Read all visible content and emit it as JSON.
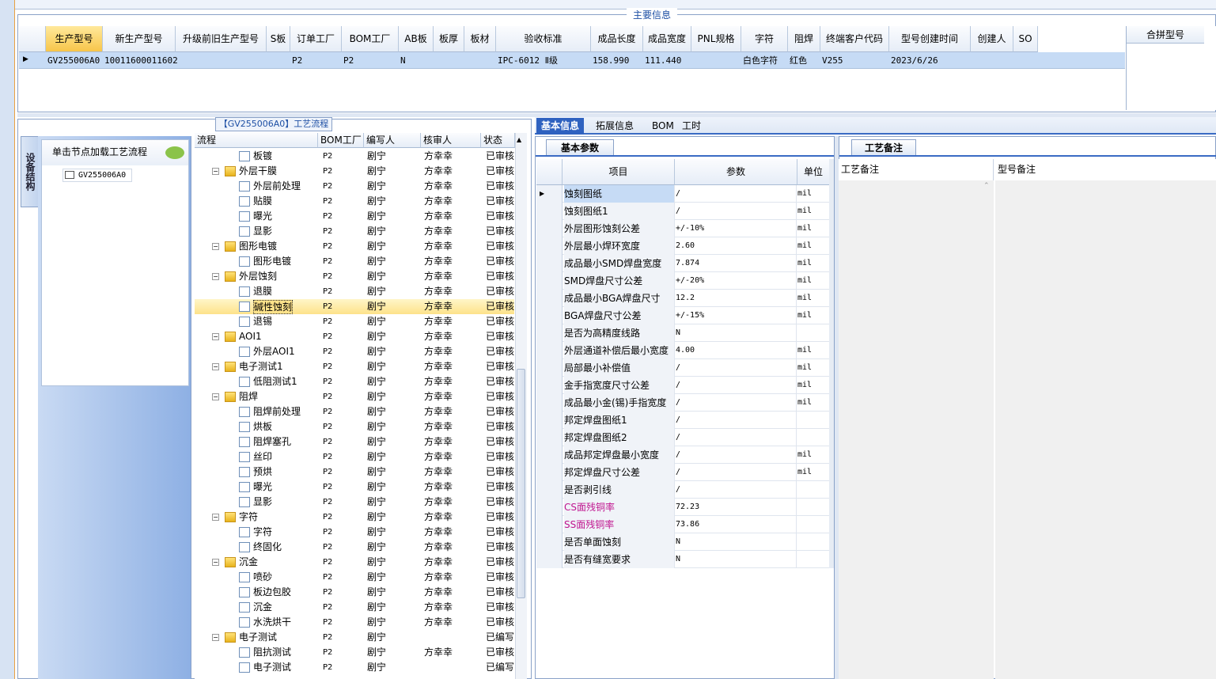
{
  "main_info": {
    "legend": "主要信息",
    "columns": [
      "生产型号",
      "新生产型号",
      "升级前旧生产型号",
      "S板",
      "订单工厂",
      "BOM工厂",
      "AB板",
      "板厚",
      "板材",
      "验收标准",
      "成品长度",
      "成品宽度",
      "PNL规格",
      "字符",
      "阻焊",
      "终端客户代码",
      "型号创建时间",
      "创建人",
      "SO"
    ],
    "row": {
      "生产型号": "GV255006A0",
      "新生产型号": "10011600011602",
      "订单工厂": "P2",
      "BOM工厂": "P2",
      "AB板": "N",
      "验收标准": "IPC-6012 Ⅱ级",
      "成品长度": "158.990",
      "成品宽度": "111.440",
      "字符": "白色字符",
      "阻焊": "红色",
      "终端客户代码": "V255",
      "型号创建时间": "2023/6/26"
    },
    "merge_header": "合拼型号"
  },
  "process": {
    "title": "【GV255006A0】工艺流程",
    "nav_tab": "设备结构",
    "nav_label": "单击节点加载工艺流程",
    "nav_item": "GV255006A0",
    "columns": [
      "流程",
      "BOM工厂",
      "编写人",
      "核审人",
      "状态"
    ],
    "rows": [
      {
        "name": "板镀",
        "level": 2,
        "f": "P2",
        "w": "剧宁",
        "r": "方幸幸",
        "s": "已审核"
      },
      {
        "name": "外层干膜",
        "level": 1,
        "f": "P2",
        "w": "剧宁",
        "r": "方幸幸",
        "s": "已审核"
      },
      {
        "name": "外层前处理",
        "level": 2,
        "f": "P2",
        "w": "剧宁",
        "r": "方幸幸",
        "s": "已审核"
      },
      {
        "name": "贴膜",
        "level": 2,
        "f": "P2",
        "w": "剧宁",
        "r": "方幸幸",
        "s": "已审核"
      },
      {
        "name": "曝光",
        "level": 2,
        "f": "P2",
        "w": "剧宁",
        "r": "方幸幸",
        "s": "已审核"
      },
      {
        "name": "显影",
        "level": 2,
        "f": "P2",
        "w": "剧宁",
        "r": "方幸幸",
        "s": "已审核"
      },
      {
        "name": "图形电镀",
        "level": 1,
        "f": "P2",
        "w": "剧宁",
        "r": "方幸幸",
        "s": "已审核"
      },
      {
        "name": "图形电镀",
        "level": 2,
        "f": "P2",
        "w": "剧宁",
        "r": "方幸幸",
        "s": "已审核"
      },
      {
        "name": "外层蚀刻",
        "level": 1,
        "f": "P2",
        "w": "剧宁",
        "r": "方幸幸",
        "s": "已审核"
      },
      {
        "name": "退膜",
        "level": 2,
        "f": "P2",
        "w": "剧宁",
        "r": "方幸幸",
        "s": "已审核"
      },
      {
        "name": "碱性蚀刻",
        "level": 2,
        "f": "P2",
        "w": "剧宁",
        "r": "方幸幸",
        "s": "已审核",
        "sel": true
      },
      {
        "name": "退锡",
        "level": 2,
        "f": "P2",
        "w": "剧宁",
        "r": "方幸幸",
        "s": "已审核"
      },
      {
        "name": "AOI1",
        "level": 1,
        "f": "P2",
        "w": "剧宁",
        "r": "方幸幸",
        "s": "已审核"
      },
      {
        "name": "外层AOI1",
        "level": 2,
        "f": "P2",
        "w": "剧宁",
        "r": "方幸幸",
        "s": "已审核"
      },
      {
        "name": "电子测试1",
        "level": 1,
        "f": "P2",
        "w": "剧宁",
        "r": "方幸幸",
        "s": "已审核"
      },
      {
        "name": "低阻测试1",
        "level": 2,
        "f": "P2",
        "w": "剧宁",
        "r": "方幸幸",
        "s": "已审核"
      },
      {
        "name": "阻焊",
        "level": 1,
        "f": "P2",
        "w": "剧宁",
        "r": "方幸幸",
        "s": "已审核"
      },
      {
        "name": "阻焊前处理",
        "level": 2,
        "f": "P2",
        "w": "剧宁",
        "r": "方幸幸",
        "s": "已审核"
      },
      {
        "name": "烘板",
        "level": 2,
        "f": "P2",
        "w": "剧宁",
        "r": "方幸幸",
        "s": "已审核"
      },
      {
        "name": "阻焊塞孔",
        "level": 2,
        "f": "P2",
        "w": "剧宁",
        "r": "方幸幸",
        "s": "已审核"
      },
      {
        "name": "丝印",
        "level": 2,
        "f": "P2",
        "w": "剧宁",
        "r": "方幸幸",
        "s": "已审核"
      },
      {
        "name": "预烘",
        "level": 2,
        "f": "P2",
        "w": "剧宁",
        "r": "方幸幸",
        "s": "已审核"
      },
      {
        "name": "曝光",
        "level": 2,
        "f": "P2",
        "w": "剧宁",
        "r": "方幸幸",
        "s": "已审核"
      },
      {
        "name": "显影",
        "level": 2,
        "f": "P2",
        "w": "剧宁",
        "r": "方幸幸",
        "s": "已审核"
      },
      {
        "name": "字符",
        "level": 1,
        "f": "P2",
        "w": "剧宁",
        "r": "方幸幸",
        "s": "已审核"
      },
      {
        "name": "字符",
        "level": 2,
        "f": "P2",
        "w": "剧宁",
        "r": "方幸幸",
        "s": "已审核"
      },
      {
        "name": "终固化",
        "level": 2,
        "f": "P2",
        "w": "剧宁",
        "r": "方幸幸",
        "s": "已审核"
      },
      {
        "name": "沉金",
        "level": 1,
        "f": "P2",
        "w": "剧宁",
        "r": "方幸幸",
        "s": "已审核"
      },
      {
        "name": "喷砂",
        "level": 2,
        "f": "P2",
        "w": "剧宁",
        "r": "方幸幸",
        "s": "已审核"
      },
      {
        "name": "板边包胶",
        "level": 2,
        "f": "P2",
        "w": "剧宁",
        "r": "方幸幸",
        "s": "已审核"
      },
      {
        "name": "沉金",
        "level": 2,
        "f": "P2",
        "w": "剧宁",
        "r": "方幸幸",
        "s": "已审核"
      },
      {
        "name": "水洗烘干",
        "level": 2,
        "f": "P2",
        "w": "剧宁",
        "r": "方幸幸",
        "s": "已审核"
      },
      {
        "name": "电子测试",
        "level": 1,
        "f": "P2",
        "w": "剧宁",
        "r": "",
        "s": "已编写"
      },
      {
        "name": "阻抗测试",
        "level": 2,
        "f": "P2",
        "w": "剧宁",
        "r": "方幸幸",
        "s": "已审核"
      },
      {
        "name": "电子测试",
        "level": 2,
        "f": "P2",
        "w": "剧宁",
        "r": "",
        "s": "已编写"
      }
    ]
  },
  "tabs": [
    "基本信息",
    "拓展信息",
    "BOM",
    "工时"
  ],
  "basic": {
    "tab": "基本参数",
    "columns": [
      "项目",
      "参数",
      "单位"
    ],
    "rows": [
      {
        "k": "蚀刻图纸",
        "v": "/",
        "u": "mil",
        "sel": true
      },
      {
        "k": "蚀刻图纸1",
        "v": "/",
        "u": "mil"
      },
      {
        "k": "外层图形蚀刻公差",
        "v": "+/-10%",
        "u": "mil"
      },
      {
        "k": "外层最小焊环宽度",
        "v": "2.60",
        "u": "mil"
      },
      {
        "k": "成品最小SMD焊盘宽度",
        "v": "7.874",
        "u": "mil"
      },
      {
        "k": "SMD焊盘尺寸公差",
        "v": "+/-20%",
        "u": "mil"
      },
      {
        "k": "成品最小BGA焊盘尺寸",
        "v": "12.2",
        "u": "mil"
      },
      {
        "k": "BGA焊盘尺寸公差",
        "v": "+/-15%",
        "u": "mil"
      },
      {
        "k": "是否为高精度线路",
        "v": "N",
        "u": ""
      },
      {
        "k": "外层通道补偿后最小宽度",
        "v": "4.00",
        "u": "mil"
      },
      {
        "k": "局部最小补偿值",
        "v": "/",
        "u": "mil"
      },
      {
        "k": "金手指宽度尺寸公差",
        "v": "/",
        "u": "mil"
      },
      {
        "k": "成品最小金(锡)手指宽度",
        "v": "/",
        "u": "mil"
      },
      {
        "k": "邦定焊盘图纸1",
        "v": "/",
        "u": ""
      },
      {
        "k": "邦定焊盘图纸2",
        "v": "/",
        "u": ""
      },
      {
        "k": "成品邦定焊盘最小宽度",
        "v": "/",
        "u": "mil"
      },
      {
        "k": "邦定焊盘尺寸公差",
        "v": "/",
        "u": "mil"
      },
      {
        "k": "是否剥引线",
        "v": "/",
        "u": ""
      },
      {
        "k": "CS面残铜率",
        "v": "72.23",
        "u": "",
        "pink": true
      },
      {
        "k": "SS面残铜率",
        "v": "73.86",
        "u": "",
        "pink": true
      },
      {
        "k": "是否单面蚀刻",
        "v": "N",
        "u": ""
      },
      {
        "k": "是否有缝宽要求",
        "v": "N",
        "u": ""
      }
    ]
  },
  "remarks": {
    "tab": "工艺备注",
    "col1": "工艺备注",
    "col2": "型号备注"
  }
}
